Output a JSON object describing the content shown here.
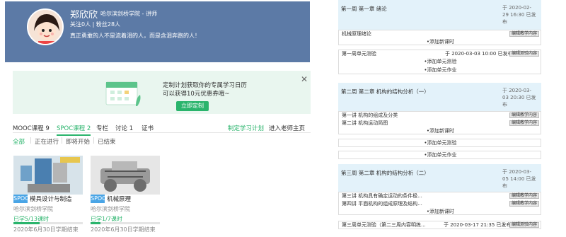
{
  "profile": {
    "name": "郑欣欣",
    "school_role": "哈尔滨剑桥学院 - 讲师",
    "stats": "关注0人 | 粉丝28人",
    "motto": "真正勇敢的人不是流着泪的人，而是含泪奔跑的人！"
  },
  "banner": {
    "line1": "定制计划获取你的专属学习日历",
    "line2": "可以获得10元优惠券哦~",
    "button": "立即定制",
    "close": "✕"
  },
  "tabs": {
    "mooc": "MOOC课程 9",
    "spoc": "SPOC课程 2",
    "column": "专栏",
    "discuss": "讨论 1",
    "cert": "证书",
    "plan": "制定学习计划",
    "teacher_home": "进入老师主页"
  },
  "filters": {
    "all": "全部",
    "ongoing": "正在进行",
    "upcoming": "即将开始",
    "ended": "已结束"
  },
  "courses": [
    {
      "tag": "SPOC",
      "title": "模具设计与制造",
      "school": "哈尔滨剑桥学院",
      "progress_text": "已学5/13课时",
      "progress": 0.38,
      "end": "2020年6月30日学期结束"
    },
    {
      "tag": "SPOC",
      "title": "机械原理",
      "school": "哈尔滨剑桥学院",
      "progress_text": "已学1/7课时",
      "progress": 0.14,
      "end": "2020年6月30日学期结束"
    }
  ],
  "schedule": {
    "ch1": {
      "title": "第一周 第一章 绪论",
      "date_l1": "于  2020-02-",
      "date_l2": "29 16:30 已发",
      "date_l3": "布"
    },
    "r1": "机械原理绪论",
    "add_lesson": "•添加新课时",
    "r2": "第一周单元测验",
    "r2_date": "于  2020-03-03 10:00 已发布",
    "add_test": "•添加单元测验",
    "add_work": "•添加单元作业",
    "ch2": {
      "title": "第二周 第二章 机构的结构分析（一）",
      "date_l1": "于  2020-03-",
      "date_l2": "03 20:30 已发",
      "date_l3": "布"
    },
    "r3": "第一讲  机构的组成及分类",
    "r4": "第二讲  机构运动简图",
    "ch3": {
      "title": "第三周 第二章 机构的结构分析（二）",
      "date_l1": "于  2020-03-",
      "date_l2": "05 14:00 已发",
      "date_l3": "布"
    },
    "r5": "第三讲  机构具有确定运动的条件极...",
    "r6": "第四讲  平面机构的组成原理及结构...",
    "r7": "第三周单元测验（第二三周内容明练...",
    "r7_date": "于  2020-03-17 21:35 已发布",
    "edit_content": "编辑教学内容",
    "edit_test": "编辑测验内容"
  }
}
